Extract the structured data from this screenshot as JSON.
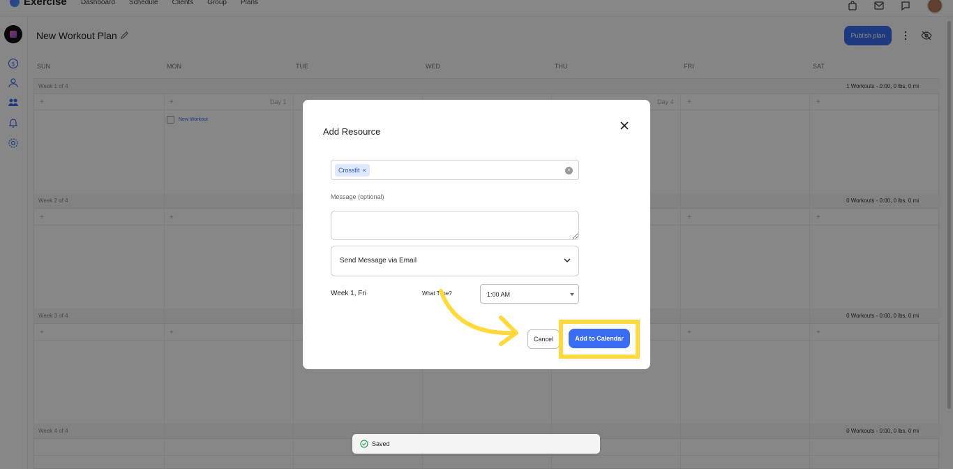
{
  "app": {
    "name": "Exercise",
    "nav": [
      "Dashboard",
      "Schedule",
      "Clients",
      "Group",
      "Plans"
    ]
  },
  "header": {
    "title": "New Workout Plan",
    "publish_label": "Publish plan"
  },
  "calendar": {
    "days": [
      "SUN",
      "MON",
      "TUE",
      "WED",
      "THU",
      "FRI",
      "SAT"
    ],
    "weeks": [
      {
        "label": "Week 1 of 4",
        "summary": "1 Workouts - 0:00, 0 lbs, 0 mi"
      },
      {
        "label": "Week 2 of 4",
        "summary": "0 Workouts - 0:00, 0 lbs, 0 mi"
      },
      {
        "label": "Week 3 of 4",
        "summary": "0 Workouts - 0:00, 0 lbs, 0 mi"
      },
      {
        "label": "Week 4 of 4",
        "summary": "0 Workouts - 0:00, 0 lbs, 0 mi"
      }
    ],
    "day1_label": "Day 1",
    "day4_label": "Day 4",
    "workout_item": "New Workout"
  },
  "modal": {
    "title": "Add Resource",
    "resource_chip": "Crossfit",
    "message_label": "Message (optional)",
    "message_value": "",
    "send_option": "Send Message via Email",
    "week_label": "Week 1, Fri",
    "time_label": "What Time?",
    "time_value": "1:00 AM",
    "cancel_label": "Cancel",
    "add_label": "Add to Calendar"
  },
  "toast": {
    "text": "Saved"
  },
  "colors": {
    "accent": "#3b6df2",
    "highlight": "#ffd93d"
  }
}
